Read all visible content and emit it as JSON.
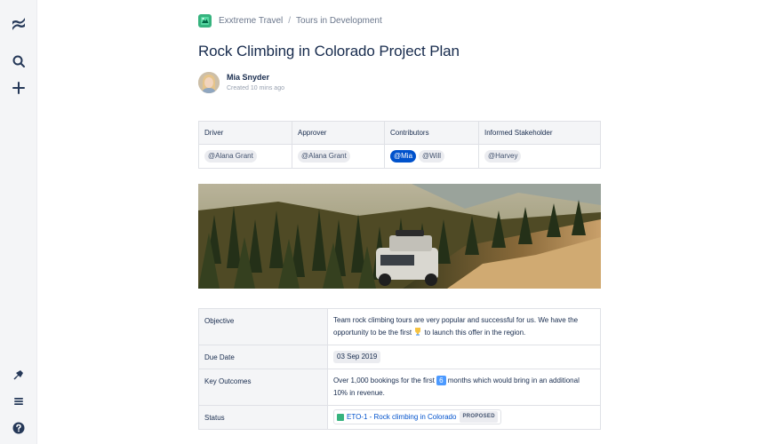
{
  "nav": {
    "icons": [
      "confluence-logo-icon",
      "search-icon",
      "create-icon",
      "notifications-icon",
      "menu-icon",
      "help-icon"
    ]
  },
  "breadcrumb": {
    "space": "Exxtreme Travel",
    "separator": "/",
    "page": "Tours in Development"
  },
  "page": {
    "title": "Rock Climbing in Colorado Project Plan",
    "author": "Mia Snyder",
    "created": "Created 10 mins ago"
  },
  "people_table": {
    "headers": [
      "Driver",
      "Approver",
      "Contributors",
      "Informed Stakeholder"
    ],
    "driver": "@Alana Grant",
    "approver": "@Alana Grant",
    "contributor_1": "@Mia",
    "contributor_2": "@Will",
    "stakeholder": "@Harvey"
  },
  "details": {
    "objective_label": "Objective",
    "objective_text_1": "Team rock climbing tours are very popular and successful for us. We have the opportunity to be the first",
    "objective_text_2": "to launch this offer in the region.",
    "due_label": "Due Date",
    "due_value": "03 Sep 2019",
    "outcomes_label": "Key Outcomes",
    "outcomes_text_1": "Over 1,000 bookings for the first",
    "outcomes_badge": "6",
    "outcomes_text_2": "months which would bring in an additional 10% in revenue.",
    "status_label": "Status",
    "jira_key_summary": "ETO-1 - Rock climbing in Colorado",
    "jira_status": "PROPOSED"
  },
  "colors": {
    "brand_blue": "#0052cc",
    "rail_bg": "#f4f5f7",
    "text": "#172b4d",
    "space_green": "#36b37e"
  }
}
